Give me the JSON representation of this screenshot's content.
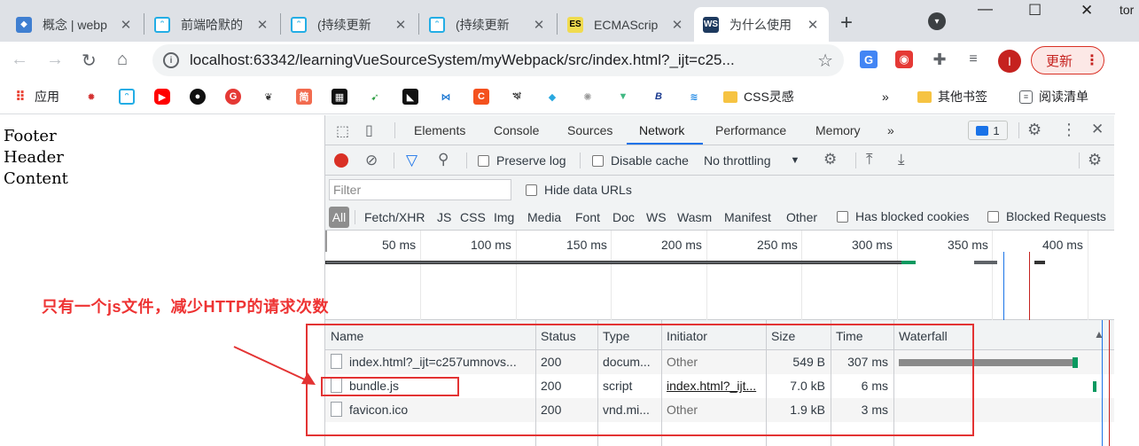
{
  "browser": {
    "tabs": [
      {
        "favicon": "box-icon",
        "title": "概念 | webp",
        "active": false
      },
      {
        "favicon": "bilibili-icon",
        "title": "前端哈默的",
        "active": false
      },
      {
        "favicon": "bilibili-icon",
        "title": "(持续更新",
        "active": false
      },
      {
        "favicon": "bilibili-icon",
        "title": "(持续更新",
        "active": false
      },
      {
        "favicon": "es-icon",
        "title": "ECMAScrip",
        "active": false
      },
      {
        "favicon": "webstorm-icon",
        "title": "为什么使用",
        "active": true
      }
    ],
    "new_tab": "+",
    "edge_text": "tor",
    "url": "localhost:63342/learningVueSourceSystem/myWebpack/src/index.html?_ijt=c25...",
    "avatar_letter": "I",
    "update_label": "更新",
    "bookmarks": [
      {
        "icon": "apps-icon",
        "label": "应用"
      },
      {
        "icon": "site-icon",
        "label": ""
      },
      {
        "icon": "bilibili-icon",
        "label": ""
      },
      {
        "icon": "youtube-icon",
        "label": ""
      },
      {
        "icon": "github-icon",
        "label": ""
      },
      {
        "icon": "g-icon",
        "label": ""
      },
      {
        "icon": "leaf-icon",
        "label": ""
      },
      {
        "icon": "jian-icon",
        "label": "简"
      },
      {
        "icon": "film-icon",
        "label": ""
      },
      {
        "icon": "bird-icon",
        "label": ""
      },
      {
        "icon": "mark-icon",
        "label": ""
      },
      {
        "icon": "blue-m-icon",
        "label": ""
      },
      {
        "icon": "c-icon",
        "label": "C"
      },
      {
        "icon": "shield-icon",
        "label": ""
      },
      {
        "icon": "diamond-icon",
        "label": ""
      },
      {
        "icon": "gear-site-icon",
        "label": ""
      },
      {
        "icon": "vue-icon",
        "label": ""
      },
      {
        "icon": "b-icon",
        "label": "B"
      },
      {
        "icon": "layers-icon",
        "label": ""
      },
      {
        "icon": "folder-icon",
        "label": "CSS灵感"
      }
    ],
    "bookmarks_more": "»",
    "other_bookmarks": "其他书签",
    "reading_list": "阅读清单"
  },
  "page": {
    "lines": [
      "Footer",
      "Header",
      "Content"
    ]
  },
  "annotation": {
    "text": "只有一个js文件，减少HTTP的请求次数",
    "color": "#e33333"
  },
  "devtools": {
    "tabs": [
      "Elements",
      "Console",
      "Sources",
      "Network",
      "Performance",
      "Memory"
    ],
    "active_tab": "Network",
    "more_tabs": "»",
    "issues_count": "1",
    "toolbar": {
      "preserve_log": "Preserve log",
      "disable_cache": "Disable cache",
      "throttling": "No throttling"
    },
    "filter": {
      "placeholder": "Filter",
      "hide_data_urls": "Hide data URLs",
      "types": [
        "All",
        "Fetch/XHR",
        "JS",
        "CSS",
        "Img",
        "Media",
        "Font",
        "Doc",
        "WS",
        "Wasm",
        "Manifest",
        "Other"
      ],
      "has_blocked_cookies": "Has blocked cookies",
      "blocked_requests": "Blocked Requests"
    },
    "overview_ticks": [
      "50 ms",
      "100 ms",
      "150 ms",
      "200 ms",
      "250 ms",
      "300 ms",
      "350 ms",
      "400 ms"
    ],
    "table": {
      "columns": [
        "Name",
        "Status",
        "Type",
        "Initiator",
        "Size",
        "Time",
        "Waterfall"
      ],
      "rows": [
        {
          "name": "index.html?_ijt=c257umnovs...",
          "status": "200",
          "type": "docum...",
          "initiator": "Other",
          "size": "549 B",
          "time": "307 ms"
        },
        {
          "name": "bundle.js",
          "status": "200",
          "type": "script",
          "initiator": "index.html?_ijt...",
          "size": "7.0 kB",
          "time": "6 ms"
        },
        {
          "name": "favicon.ico",
          "status": "200",
          "type": "vnd.mi...",
          "initiator": "Other",
          "size": "1.9 kB",
          "time": "3 ms"
        }
      ]
    }
  }
}
